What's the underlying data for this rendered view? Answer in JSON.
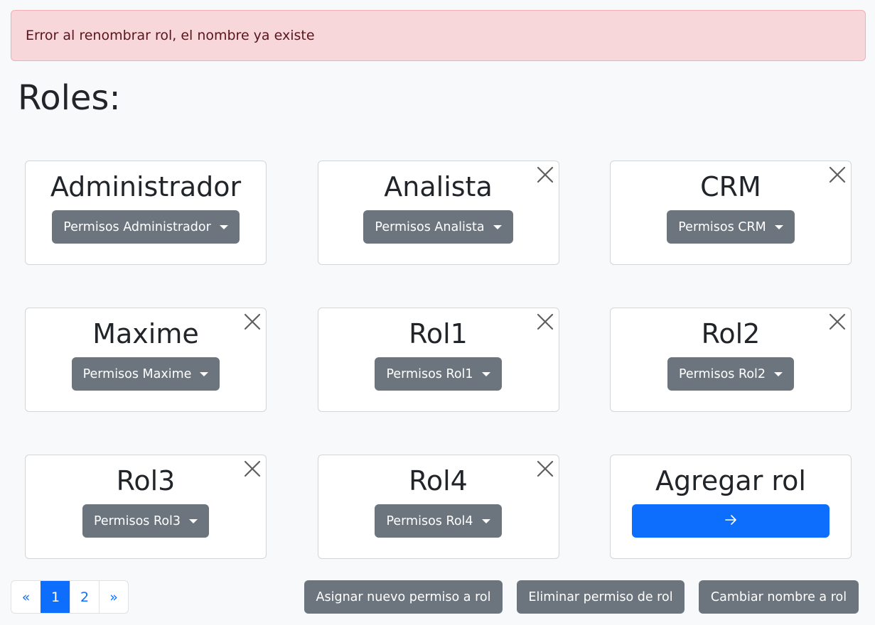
{
  "alert": {
    "message": "Error al renombrar rol, el nombre ya existe"
  },
  "page_title": "Roles:",
  "roles": [
    {
      "name": "Administrador",
      "permissions_label": "Permisos Administrador",
      "deletable": false
    },
    {
      "name": "Analista",
      "permissions_label": "Permisos Analista",
      "deletable": true
    },
    {
      "name": "CRM",
      "permissions_label": "Permisos CRM",
      "deletable": true
    },
    {
      "name": "Maxime",
      "permissions_label": "Permisos Maxime",
      "deletable": true
    },
    {
      "name": "Rol1",
      "permissions_label": "Permisos Rol1",
      "deletable": true
    },
    {
      "name": "Rol2",
      "permissions_label": "Permisos Rol2",
      "deletable": true
    },
    {
      "name": "Rol3",
      "permissions_label": "Permisos Rol3",
      "deletable": true
    },
    {
      "name": "Rol4",
      "permissions_label": "Permisos Rol4",
      "deletable": true
    }
  ],
  "add_role": {
    "title": "Agregar rol",
    "button_icon": "arrow-right-icon"
  },
  "pagination": {
    "prev": "«",
    "pages": [
      "1",
      "2"
    ],
    "next": "»",
    "current_page": "1"
  },
  "actions": {
    "assign_permission": "Asignar nuevo permiso a rol",
    "remove_permission": "Eliminar permiso de rol",
    "rename_role": "Cambiar nombre a rol"
  },
  "icons": {
    "close": "close-icon",
    "dropdown": "caret-down-icon"
  },
  "colors": {
    "alert_bg": "#f8d7da",
    "alert_text": "#58151c",
    "secondary": "#6c757d",
    "primary": "#0d6efd",
    "page_bg": "#f8f9fa"
  }
}
